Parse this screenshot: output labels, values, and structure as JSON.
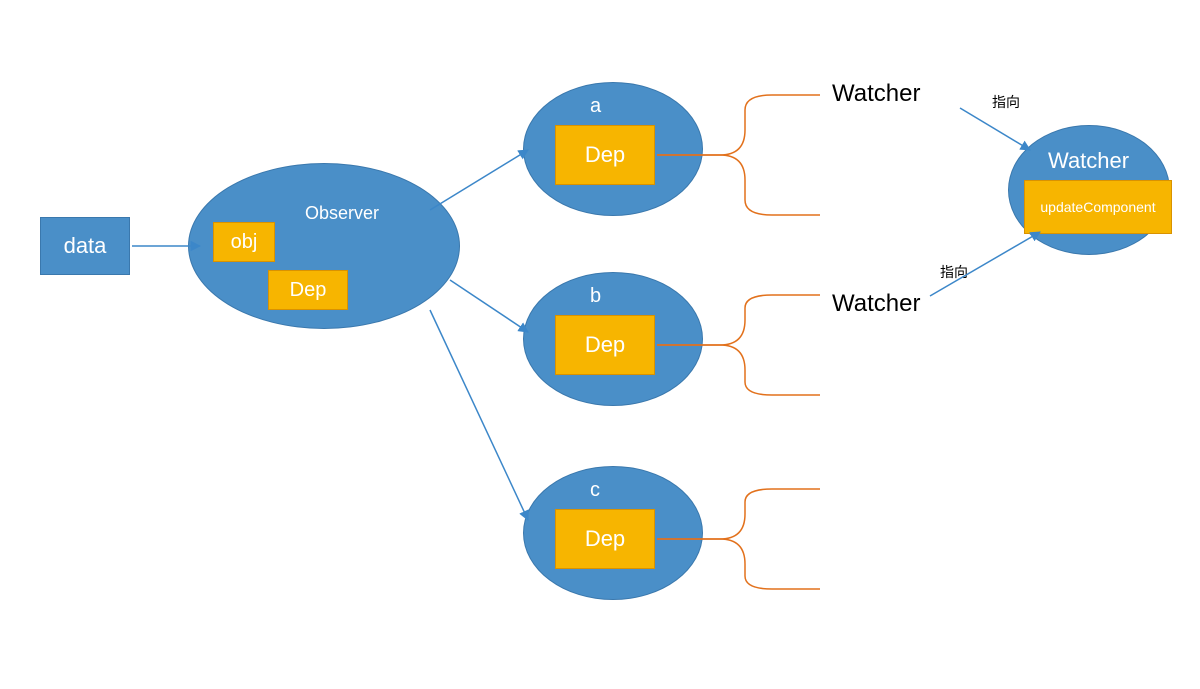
{
  "nodes": {
    "data": {
      "label": "data"
    },
    "observer": {
      "title": "Observer",
      "obj": "obj",
      "dep": "Dep"
    },
    "prop_a": {
      "name": "a",
      "dep": "Dep"
    },
    "prop_b": {
      "name": "b",
      "dep": "Dep"
    },
    "prop_c": {
      "name": "c",
      "dep": "Dep"
    },
    "watcher_a_label": "Watcher",
    "watcher_b_label": "Watcher",
    "arrow_label_1": "指向",
    "arrow_label_2": "指向",
    "watcher_node": {
      "title": "Watcher",
      "box": "updateComponent"
    }
  },
  "colors": {
    "blue": "#4a8fc8",
    "blue_border": "#3a78ad",
    "orange": "#f7b500",
    "orange_border": "#d99200",
    "arrow_blue": "#3c87c9",
    "bracket_orange": "#e2711c"
  }
}
